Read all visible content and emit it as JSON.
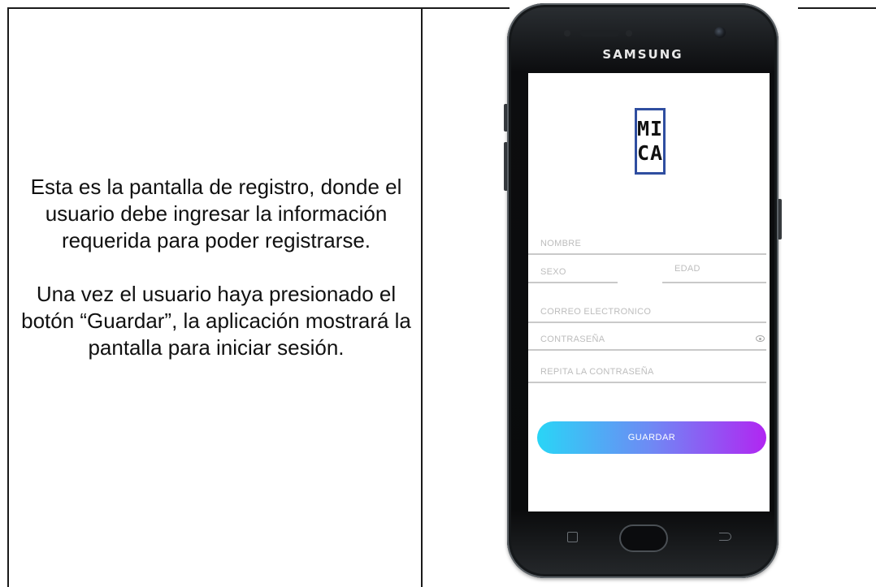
{
  "description": {
    "paragraph1": "Esta es la pantalla de registro, donde el usuario debe ingresar la información requerida para poder registrarse.",
    "paragraph2": "Una vez el usuario haya presionado el botón “Guardar”, la aplicación mostrará la pantalla para iniciar sesión."
  },
  "phone": {
    "brand": "SAMSUNG"
  },
  "app": {
    "logo_line1": "MI",
    "logo_line2": "CA",
    "logo_color": "#2f4ea0",
    "fields": {
      "nombre": "NOMBRE",
      "sexo": "SEXO",
      "edad": "EDAD",
      "correo": "CORREO ELECTRONICO",
      "contrasena": "CONTRASEÑA",
      "repita": "REPITA LA CONTRASEÑA"
    },
    "save_button": "GUARDAR",
    "button_gradient": [
      "#29d5f6",
      "#b126f2"
    ]
  }
}
